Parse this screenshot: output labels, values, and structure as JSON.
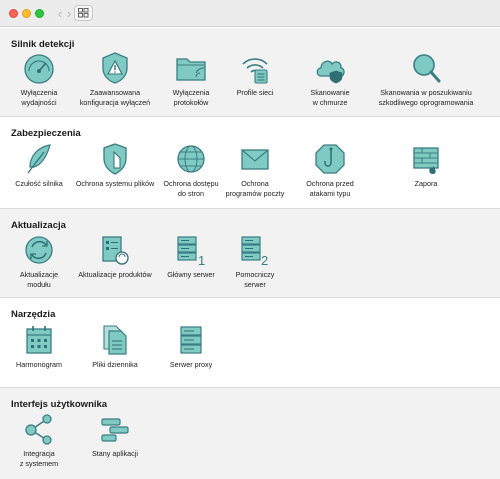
{
  "colors": {
    "icon_fill": "#80cac4",
    "icon_stroke": "#3a7d82",
    "icon_dark": "#2f6f74"
  },
  "toolbar": {
    "back_icon": "chevron-left-icon",
    "forward_icon": "chevron-right-icon",
    "grid_icon": "grid-icon"
  },
  "sections": [
    {
      "title": "Silnik detekcji",
      "items": [
        {
          "label": "Wyłączenia\nwydajności",
          "icon": "gauge-icon"
        },
        {
          "label": "Zaawansowana\nkonfiguracja wyłączeń",
          "icon": "warning-shield-icon"
        },
        {
          "label": "Wyłączenia\nprotokołów",
          "icon": "folder-icon"
        },
        {
          "label": "Profile sieci",
          "icon": "wifi-icon"
        },
        {
          "label": "Skanowanie\nw chmurze",
          "icon": "cloud-icon"
        },
        {
          "label": "Skanowania w poszukiwaniu\nszkodliwego oprogramowania",
          "icon": "magnifier-icon"
        }
      ]
    },
    {
      "title": "Zabezpieczenia",
      "items": [
        {
          "label": "Czułość silnika",
          "icon": "feather-icon"
        },
        {
          "label": "Ochrona systemu plików",
          "icon": "file-shield-icon"
        },
        {
          "label": "Ochrona dostępu\ndo stron",
          "icon": "globe-icon"
        },
        {
          "label": "Ochrona\nprogramów poczty",
          "icon": "envelope-icon"
        },
        {
          "label": "Ochrona przed\natakami typu",
          "icon": "hook-icon"
        },
        {
          "label": "Zapora",
          "icon": "firewall-icon"
        }
      ]
    },
    {
      "title": "Aktualizacja",
      "items": [
        {
          "label": "Aktualizacje\nmodułu",
          "icon": "refresh-icon"
        },
        {
          "label": "Aktualizacje produktów",
          "icon": "product-update-icon"
        },
        {
          "label": "Główny serwer",
          "icon": "server-1-icon"
        },
        {
          "label": "Pomocniczy\nserwer",
          "icon": "server-2-icon"
        }
      ]
    },
    {
      "title": "Narzędzia",
      "items": [
        {
          "label": "Harmonogram",
          "icon": "calendar-icon"
        },
        {
          "label": "Pliki dziennika",
          "icon": "log-files-icon"
        },
        {
          "label": "Serwer proxy",
          "icon": "proxy-server-icon"
        }
      ]
    },
    {
      "title": "Interfejs użytkownika",
      "items": [
        {
          "label": "Integracja\nz systemem",
          "icon": "share-icon"
        },
        {
          "label": "Stany aplikacji",
          "icon": "app-states-icon"
        }
      ]
    }
  ]
}
